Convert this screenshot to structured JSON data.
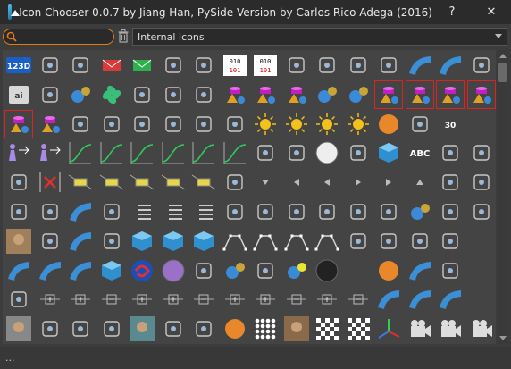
{
  "window": {
    "title": "Icon Chooser 0.0.7 by Jiang Han, PySide Version by Carlos Rico Adega (2016)",
    "help_label": "?",
    "close_label": "✕"
  },
  "filter": {
    "search_value": "",
    "category_selected": "Internal Icons"
  },
  "status": {
    "text": "..."
  },
  "icons": [
    [
      "blue-tile-123d",
      "eraser",
      "grid-square",
      "red-envelope",
      "green-envelope",
      "bookmark-pin",
      "stack-plus",
      "binary-grid",
      "binary-grid-2",
      "cursor-plus",
      "nodes-link",
      "figure-joints",
      "clock-arrow",
      "twist-plane",
      "blue-surface",
      "stack-up"
    ],
    [
      "ai-tile",
      "target-rotate",
      "arrows-ball",
      "green-fan",
      "diagonal-arrow",
      "vertical-arrows",
      "curve-arrows",
      "magenta-pipe",
      "magenta-cone",
      "magenta-ball",
      "sphere-cone",
      "sphere-cone-2",
      "magenta-cap-sel",
      "magenta-cap-sel-2",
      "magenta-cap-sel-3",
      "magenta-cap-sel-4"
    ],
    [
      "magenta-cap-sel-5",
      "magenta-cone-2",
      "green-wave",
      "blocks",
      "split-arrows",
      "bracket-dots",
      "dots-box",
      "down-arrow-green",
      "sun-sphere",
      "sun",
      "sun-2",
      "sun-3",
      "gear-orange",
      "angle-t",
      "number-30",
      ""
    ],
    [
      "people-arrows",
      "people-arrows-2",
      "green-curve",
      "green-curve-2",
      "green-curve-3",
      "green-curve-4",
      "green-curve-5",
      "green-curve-6",
      "runner",
      "eye-ring",
      "white-sphere",
      "t-box",
      "blue-cube",
      "text-abc",
      "blue-square",
      "arrows-lr"
    ],
    [
      "ring-arrow",
      "red-x",
      "yellow-box",
      "yellow-box-2",
      "yellow-box-3",
      "yellow-box-4",
      "yellow-box-5",
      "film-strip",
      "triangle-down",
      "triangle-left",
      "triangle-left-2",
      "triangle-right",
      "triangle-right-2",
      "triangle-up",
      "target-disk",
      "disk-brush"
    ],
    [
      "cylinder",
      "sine-wave",
      "blue-plane",
      "pipe-end",
      "list-lines",
      "list-lines-2",
      "list-arrows",
      "rings",
      "rotation-red",
      "window-red",
      "camera-target",
      "camera-red",
      "film-bars",
      "blue-balls",
      "dice",
      "printer"
    ],
    [
      "face-portrait",
      "film-yellow",
      "blue-arch",
      "layer-grid",
      "blue-cube-2",
      "blue-cube-3",
      "blue-cube-4",
      "curve-nodes",
      "curve-nodes-2",
      "curve-nodes-3",
      "curve-nodes-4",
      "chain-link",
      "bracket-node",
      "bracket-node-2",
      "loop-blue",
      ""
    ],
    [
      "teal-wave",
      "blue-arch-2",
      "blue-arch-3",
      "small-cube",
      "swirl-red",
      "purple-circle",
      "window-purple",
      "spheres-blue",
      "green-box",
      "green-balls",
      "black-sphere",
      "",
      "orange-doc",
      "blue-bend",
      "gray-shape",
      ""
    ],
    [
      "magnifier",
      "plus-box",
      "plus-box-2",
      "corner-line",
      "plus-line",
      "plus-box-3",
      "minus-box",
      "plus-box-4",
      "plus-line-2",
      "minus-line",
      "plus-box-5",
      "minus-box-2",
      "blue-ribbon",
      "blue-ribbon-2",
      "blue-ribbon-3",
      ""
    ],
    [
      "noise-texture",
      "white-brush",
      "brown-brush",
      "refresh-drop",
      "snow-rock",
      "refresh-arrow",
      "refresh-gear",
      "orange-refresh",
      "dots-grid",
      "dog-photo",
      "checker",
      "checker-cube",
      "axis-arrows",
      "film-camera",
      "film-camera-2",
      "film-camera-3"
    ]
  ],
  "selected_icons": [
    "magenta-cap-sel",
    "magenta-cap-sel-2",
    "magenta-cap-sel-3",
    "magenta-cap-sel-4",
    "magenta-cap-sel-5"
  ],
  "icon_text": {
    "blue-tile-123d": "123D",
    "ai-tile": "ai",
    "text-abc": "ABC",
    "number-30": "30"
  },
  "colors": {
    "accent_orange": "#e07a16",
    "selection_red": "#d22222",
    "titlebar": "#2b2b2b",
    "panel": "#444444"
  }
}
